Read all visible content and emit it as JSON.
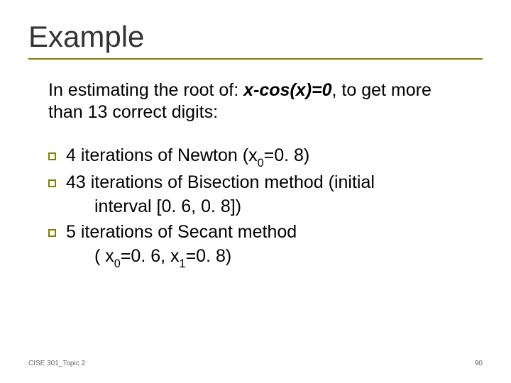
{
  "title": "Example",
  "intro": {
    "prefix": "In estimating the root of: ",
    "equation": "x-cos(x)=0",
    "suffix": ", to get more than 13 correct digits:"
  },
  "bullets": {
    "b1": {
      "line1a": " 4 iterations of Newton (x",
      "sub1": "0",
      "line1b": "=0. 8)"
    },
    "b2": {
      "line1": "43 iterations of Bisection method (initial",
      "line2": "interval [0. 6, 0. 8])"
    },
    "b3": {
      "line1": "5 iterations of Secant method",
      "line2a": "( x",
      "sub0": "0",
      "line2b": "=0. 6, x",
      "sub1": "1",
      "line2c": "=0. 8)"
    }
  },
  "footer": {
    "left": "CISE 301_Topic 2",
    "right": "90"
  }
}
